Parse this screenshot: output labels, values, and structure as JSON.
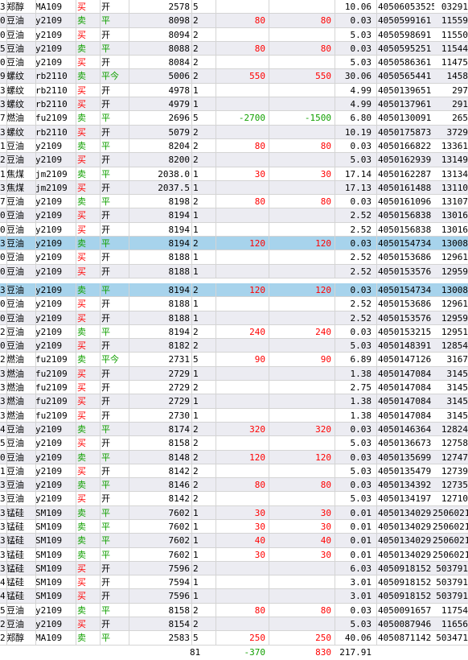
{
  "rows": [
    {
      "idx": "3",
      "name": "郑醇",
      "code": "MA109",
      "dir": "买",
      "kp": "开",
      "price": "2578",
      "qty": "5",
      "p1": "",
      "p2": "",
      "fee": "10.06",
      "ord": "40506053525",
      "trd": "03291",
      "bg": "plain"
    },
    {
      "idx": "0",
      "name": "豆油",
      "code": "y2109",
      "dir": "卖",
      "kp": "平",
      "price": "8098",
      "qty": "2",
      "p1": "80",
      "p2": "80",
      "fee": "0.03",
      "ord": "4050599161",
      "trd": "11559",
      "bg": "alt"
    },
    {
      "idx": "0",
      "name": "豆油",
      "code": "y2109",
      "dir": "买",
      "kp": "开",
      "price": "8094",
      "qty": "2",
      "p1": "",
      "p2": "",
      "fee": "5.03",
      "ord": "4050598691",
      "trd": "11550",
      "bg": "plain"
    },
    {
      "idx": "5",
      "name": "豆油",
      "code": "y2109",
      "dir": "卖",
      "kp": "平",
      "price": "8088",
      "qty": "2",
      "p1": "80",
      "p2": "80",
      "fee": "0.03",
      "ord": "4050595251",
      "trd": "11544",
      "bg": "alt"
    },
    {
      "idx": "0",
      "name": "豆油",
      "code": "y2109",
      "dir": "买",
      "kp": "开",
      "price": "8084",
      "qty": "2",
      "p1": "",
      "p2": "",
      "fee": "5.03",
      "ord": "4050586361",
      "trd": "11475",
      "bg": "plain"
    },
    {
      "idx": "9",
      "name": "螺纹",
      "code": "rb2110",
      "dir": "卖",
      "kp": "平今",
      "price": "5006",
      "qty": "2",
      "p1": "550",
      "p2": "550",
      "fee": "30.06",
      "ord": "4050565441",
      "trd": "1458",
      "bg": "alt"
    },
    {
      "idx": "3",
      "name": "螺纹",
      "code": "rb2110",
      "dir": "买",
      "kp": "开",
      "price": "4978",
      "qty": "1",
      "p1": "",
      "p2": "",
      "fee": "4.99",
      "ord": "4050139651",
      "trd": "297",
      "bg": "plain"
    },
    {
      "idx": "3",
      "name": "螺纹",
      "code": "rb2110",
      "dir": "买",
      "kp": "开",
      "price": "4979",
      "qty": "1",
      "p1": "",
      "p2": "",
      "fee": "4.99",
      "ord": "4050137961",
      "trd": "291",
      "bg": "alt"
    },
    {
      "idx": "7",
      "name": "燃油",
      "code": "fu2109",
      "dir": "卖",
      "kp": "平",
      "price": "2696",
      "qty": "5",
      "p1": "-2700",
      "p2": "-1500",
      "fee": "6.80",
      "ord": "4050130091",
      "trd": "265",
      "bg": "plain"
    },
    {
      "idx": "3",
      "name": "螺纹",
      "code": "rb2110",
      "dir": "买",
      "kp": "开",
      "price": "5079",
      "qty": "2",
      "p1": "",
      "p2": "",
      "fee": "10.19",
      "ord": "4050175873",
      "trd": "3729",
      "bg": "alt"
    },
    {
      "idx": "1",
      "name": "豆油",
      "code": "y2109",
      "dir": "卖",
      "kp": "平",
      "price": "8204",
      "qty": "2",
      "p1": "80",
      "p2": "80",
      "fee": "0.03",
      "ord": "4050166822",
      "trd": "13361",
      "bg": "plain"
    },
    {
      "idx": "2",
      "name": "豆油",
      "code": "y2109",
      "dir": "买",
      "kp": "开",
      "price": "8200",
      "qty": "2",
      "p1": "",
      "p2": "",
      "fee": "5.03",
      "ord": "4050162939",
      "trd": "13149",
      "bg": "alt"
    },
    {
      "idx": "1",
      "name": "焦煤",
      "code": "jm2109",
      "dir": "卖",
      "kp": "平",
      "price": "2038.0",
      "qty": "1",
      "p1": "30",
      "p2": "30",
      "fee": "17.14",
      "ord": "4050162287",
      "trd": "13134",
      "bg": "plain"
    },
    {
      "idx": "3",
      "name": "焦煤",
      "code": "jm2109",
      "dir": "买",
      "kp": "开",
      "price": "2037.5",
      "qty": "1",
      "p1": "",
      "p2": "",
      "fee": "17.13",
      "ord": "4050161488",
      "trd": "13110",
      "bg": "alt"
    },
    {
      "idx": "7",
      "name": "豆油",
      "code": "y2109",
      "dir": "卖",
      "kp": "平",
      "price": "8198",
      "qty": "2",
      "p1": "80",
      "p2": "80",
      "fee": "0.03",
      "ord": "4050161096",
      "trd": "13107",
      "bg": "plain"
    },
    {
      "idx": "0",
      "name": "豆油",
      "code": "y2109",
      "dir": "买",
      "kp": "开",
      "price": "8194",
      "qty": "1",
      "p1": "",
      "p2": "",
      "fee": "2.52",
      "ord": "4050156838",
      "trd": "13016",
      "bg": "alt"
    },
    {
      "idx": "0",
      "name": "豆油",
      "code": "y2109",
      "dir": "买",
      "kp": "开",
      "price": "8194",
      "qty": "1",
      "p1": "",
      "p2": "",
      "fee": "2.52",
      "ord": "4050156838",
      "trd": "13016",
      "bg": "plain"
    },
    {
      "idx": "3",
      "name": "豆油",
      "code": "y2109",
      "dir": "卖",
      "kp": "平",
      "price": "8194",
      "qty": "2",
      "p1": "120",
      "p2": "120",
      "fee": "0.03",
      "ord": "4050154734",
      "trd": "13008",
      "bg": "selected"
    },
    {
      "idx": "0",
      "name": "豆油",
      "code": "y2109",
      "dir": "买",
      "kp": "开",
      "price": "8188",
      "qty": "1",
      "p1": "",
      "p2": "",
      "fee": "2.52",
      "ord": "4050153686",
      "trd": "12961",
      "bg": "plain"
    },
    {
      "idx": "0",
      "name": "豆油",
      "code": "y2109",
      "dir": "买",
      "kp": "开",
      "price": "8188",
      "qty": "1",
      "p1": "",
      "p2": "",
      "fee": "2.52",
      "ord": "4050153576",
      "trd": "12959",
      "bg": "alt"
    },
    {
      "idx": "",
      "name": "",
      "code": "",
      "dir": "",
      "kp": "",
      "price": "",
      "qty": "",
      "p1": "",
      "p2": "",
      "fee": "",
      "ord": "",
      "trd": "",
      "bg": "gap"
    },
    {
      "idx": "3",
      "name": "豆油",
      "code": "y2109",
      "dir": "卖",
      "kp": "平",
      "price": "8194",
      "qty": "2",
      "p1": "120",
      "p2": "120",
      "fee": "0.03",
      "ord": "4050154734",
      "trd": "13008",
      "bg": "selected"
    },
    {
      "idx": "0",
      "name": "豆油",
      "code": "y2109",
      "dir": "买",
      "kp": "开",
      "price": "8188",
      "qty": "1",
      "p1": "",
      "p2": "",
      "fee": "2.52",
      "ord": "4050153686",
      "trd": "12961",
      "bg": "plain"
    },
    {
      "idx": "0",
      "name": "豆油",
      "code": "y2109",
      "dir": "买",
      "kp": "开",
      "price": "8188",
      "qty": "1",
      "p1": "",
      "p2": "",
      "fee": "2.52",
      "ord": "4050153576",
      "trd": "12959",
      "bg": "alt"
    },
    {
      "idx": "2",
      "name": "豆油",
      "code": "y2109",
      "dir": "卖",
      "kp": "平",
      "price": "8194",
      "qty": "2",
      "p1": "240",
      "p2": "240",
      "fee": "0.03",
      "ord": "4050153215",
      "trd": "12951",
      "bg": "plain"
    },
    {
      "idx": "0",
      "name": "豆油",
      "code": "y2109",
      "dir": "买",
      "kp": "开",
      "price": "8182",
      "qty": "2",
      "p1": "",
      "p2": "",
      "fee": "5.03",
      "ord": "4050148391",
      "trd": "12854",
      "bg": "alt"
    },
    {
      "idx": "2",
      "name": "燃油",
      "code": "fu2109",
      "dir": "卖",
      "kp": "平今",
      "price": "2731",
      "qty": "5",
      "p1": "90",
      "p2": "90",
      "fee": "6.89",
      "ord": "4050147126",
      "trd": "3167",
      "bg": "plain"
    },
    {
      "idx": "3",
      "name": "燃油",
      "code": "fu2109",
      "dir": "买",
      "kp": "开",
      "price": "2729",
      "qty": "1",
      "p1": "",
      "p2": "",
      "fee": "1.38",
      "ord": "4050147084",
      "trd": "3145",
      "bg": "alt"
    },
    {
      "idx": "3",
      "name": "燃油",
      "code": "fu2109",
      "dir": "买",
      "kp": "开",
      "price": "2729",
      "qty": "2",
      "p1": "",
      "p2": "",
      "fee": "2.75",
      "ord": "4050147084",
      "trd": "3145",
      "bg": "plain"
    },
    {
      "idx": "3",
      "name": "燃油",
      "code": "fu2109",
      "dir": "买",
      "kp": "开",
      "price": "2729",
      "qty": "1",
      "p1": "",
      "p2": "",
      "fee": "1.38",
      "ord": "4050147084",
      "trd": "3145",
      "bg": "alt"
    },
    {
      "idx": "3",
      "name": "燃油",
      "code": "fu2109",
      "dir": "买",
      "kp": "开",
      "price": "2730",
      "qty": "1",
      "p1": "",
      "p2": "",
      "fee": "1.38",
      "ord": "4050147084",
      "trd": "3145",
      "bg": "plain"
    },
    {
      "idx": "4",
      "name": "豆油",
      "code": "y2109",
      "dir": "卖",
      "kp": "平",
      "price": "8174",
      "qty": "2",
      "p1": "320",
      "p2": "320",
      "fee": "0.03",
      "ord": "4050146364",
      "trd": "12824",
      "bg": "alt"
    },
    {
      "idx": "5",
      "name": "豆油",
      "code": "y2109",
      "dir": "买",
      "kp": "开",
      "price": "8158",
      "qty": "2",
      "p1": "",
      "p2": "",
      "fee": "5.03",
      "ord": "4050136673",
      "trd": "12758",
      "bg": "plain"
    },
    {
      "idx": "0",
      "name": "豆油",
      "code": "y2109",
      "dir": "卖",
      "kp": "平",
      "price": "8148",
      "qty": "2",
      "p1": "120",
      "p2": "120",
      "fee": "0.03",
      "ord": "4050135699",
      "trd": "12747",
      "bg": "alt"
    },
    {
      "idx": "1",
      "name": "豆油",
      "code": "y2109",
      "dir": "买",
      "kp": "开",
      "price": "8142",
      "qty": "2",
      "p1": "",
      "p2": "",
      "fee": "5.03",
      "ord": "4050135479",
      "trd": "12739",
      "bg": "plain"
    },
    {
      "idx": "3",
      "name": "豆油",
      "code": "y2109",
      "dir": "卖",
      "kp": "平",
      "price": "8146",
      "qty": "2",
      "p1": "80",
      "p2": "80",
      "fee": "0.03",
      "ord": "4050134392",
      "trd": "12735",
      "bg": "alt"
    },
    {
      "idx": "3",
      "name": "豆油",
      "code": "y2109",
      "dir": "买",
      "kp": "开",
      "price": "8142",
      "qty": "2",
      "p1": "",
      "p2": "",
      "fee": "5.03",
      "ord": "4050134197",
      "trd": "12710",
      "bg": "plain"
    },
    {
      "idx": "3",
      "name": "锰硅",
      "code": "SM109",
      "dir": "卖",
      "kp": "平",
      "price": "7602",
      "qty": "1",
      "p1": "30",
      "p2": "30",
      "fee": "0.01",
      "ord": "4050134029",
      "trd": "2506021",
      "bg": "alt"
    },
    {
      "idx": "3",
      "name": "锰硅",
      "code": "SM109",
      "dir": "卖",
      "kp": "平",
      "price": "7602",
      "qty": "1",
      "p1": "30",
      "p2": "30",
      "fee": "0.01",
      "ord": "4050134029",
      "trd": "2506021",
      "bg": "plain"
    },
    {
      "idx": "3",
      "name": "锰硅",
      "code": "SM109",
      "dir": "卖",
      "kp": "平",
      "price": "7602",
      "qty": "1",
      "p1": "40",
      "p2": "40",
      "fee": "0.01",
      "ord": "4050134029",
      "trd": "2506021",
      "bg": "alt"
    },
    {
      "idx": "3",
      "name": "锰硅",
      "code": "SM109",
      "dir": "卖",
      "kp": "平",
      "price": "7602",
      "qty": "1",
      "p1": "30",
      "p2": "30",
      "fee": "0.01",
      "ord": "4050134029",
      "trd": "2506021",
      "bg": "plain"
    },
    {
      "idx": "3",
      "name": "锰硅",
      "code": "SM109",
      "dir": "买",
      "kp": "开",
      "price": "7596",
      "qty": "2",
      "p1": "",
      "p2": "",
      "fee": "6.03",
      "ord": "4050918152",
      "trd": "503791",
      "bg": "alt"
    },
    {
      "idx": "4",
      "name": "锰硅",
      "code": "SM109",
      "dir": "买",
      "kp": "开",
      "price": "7594",
      "qty": "1",
      "p1": "",
      "p2": "",
      "fee": "3.01",
      "ord": "4050918152",
      "trd": "503791",
      "bg": "plain"
    },
    {
      "idx": "4",
      "name": "锰硅",
      "code": "SM109",
      "dir": "买",
      "kp": "开",
      "price": "7596",
      "qty": "1",
      "p1": "",
      "p2": "",
      "fee": "3.01",
      "ord": "4050918152",
      "trd": "503791",
      "bg": "alt"
    },
    {
      "idx": "5",
      "name": "豆油",
      "code": "y2109",
      "dir": "卖",
      "kp": "平",
      "price": "8158",
      "qty": "2",
      "p1": "80",
      "p2": "80",
      "fee": "0.03",
      "ord": "4050091657",
      "trd": "11754",
      "bg": "plain"
    },
    {
      "idx": "2",
      "name": "豆油",
      "code": "y2109",
      "dir": "买",
      "kp": "开",
      "price": "8154",
      "qty": "2",
      "p1": "",
      "p2": "",
      "fee": "5.03",
      "ord": "4050087946",
      "trd": "11656",
      "bg": "alt"
    },
    {
      "idx": "2",
      "name": "郑醇",
      "code": "MA109",
      "dir": "卖",
      "kp": "平",
      "price": "2583",
      "qty": "5",
      "p1": "250",
      "p2": "250",
      "fee": "40.06",
      "ord": "4050871142",
      "trd": "503471",
      "bg": "plain"
    }
  ],
  "summary": {
    "qty": "81",
    "p1": "-370",
    "p2": "830",
    "fee": "217.91"
  },
  "colors": {
    "buy": "#ff0000",
    "sell": "#11a000",
    "positive": "#ff0000",
    "negative": "#11a000",
    "selected": "#a7d3ec",
    "alt": "#ececf2"
  }
}
